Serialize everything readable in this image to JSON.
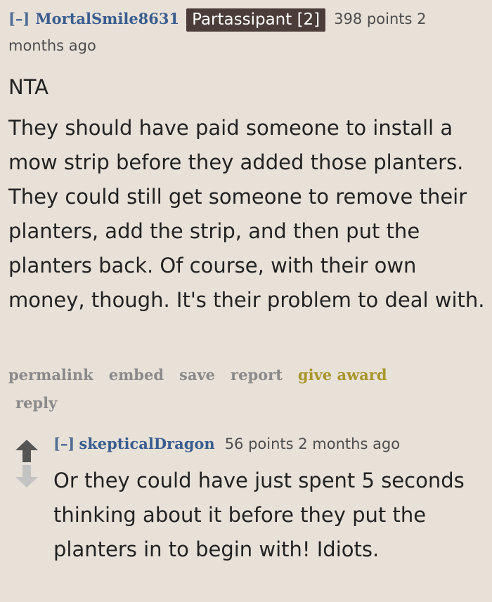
{
  "comment": {
    "toggle": "[–]",
    "author": "MortalSmile8631",
    "flair": "Partassipant [2]",
    "score_line": "398 points 2 months ago",
    "paragraphs": [
      "NTA",
      "They should have paid someone to install a mow strip before they added those planters. They could still get someone to remove their planters, add the strip, and then put the planters back. Of course, with their own money, though. It's their problem to deal with."
    ],
    "buttons": {
      "permalink": "permalink",
      "embed": "embed",
      "save": "save",
      "report": "report",
      "give_award": "give award",
      "reply": "reply"
    }
  },
  "child": {
    "toggle": "[–]",
    "author": "skepticalDragon",
    "score_line": "56 points 2 months ago",
    "body": "Or they could have just spent 5 seconds thinking about it before they put the planters in to begin with! Idiots."
  },
  "icons": {
    "upvote": "upvote-arrow-icon",
    "downvote": "downvote-arrow-icon"
  },
  "colors": {
    "background": "#e8e1d8",
    "author": "#3a5d8f",
    "flair_bg": "#4a3c38",
    "award": "#a8962a",
    "button_text": "#8a8a8a",
    "upvote": "#555555",
    "downvote": "#c3c3c3"
  }
}
